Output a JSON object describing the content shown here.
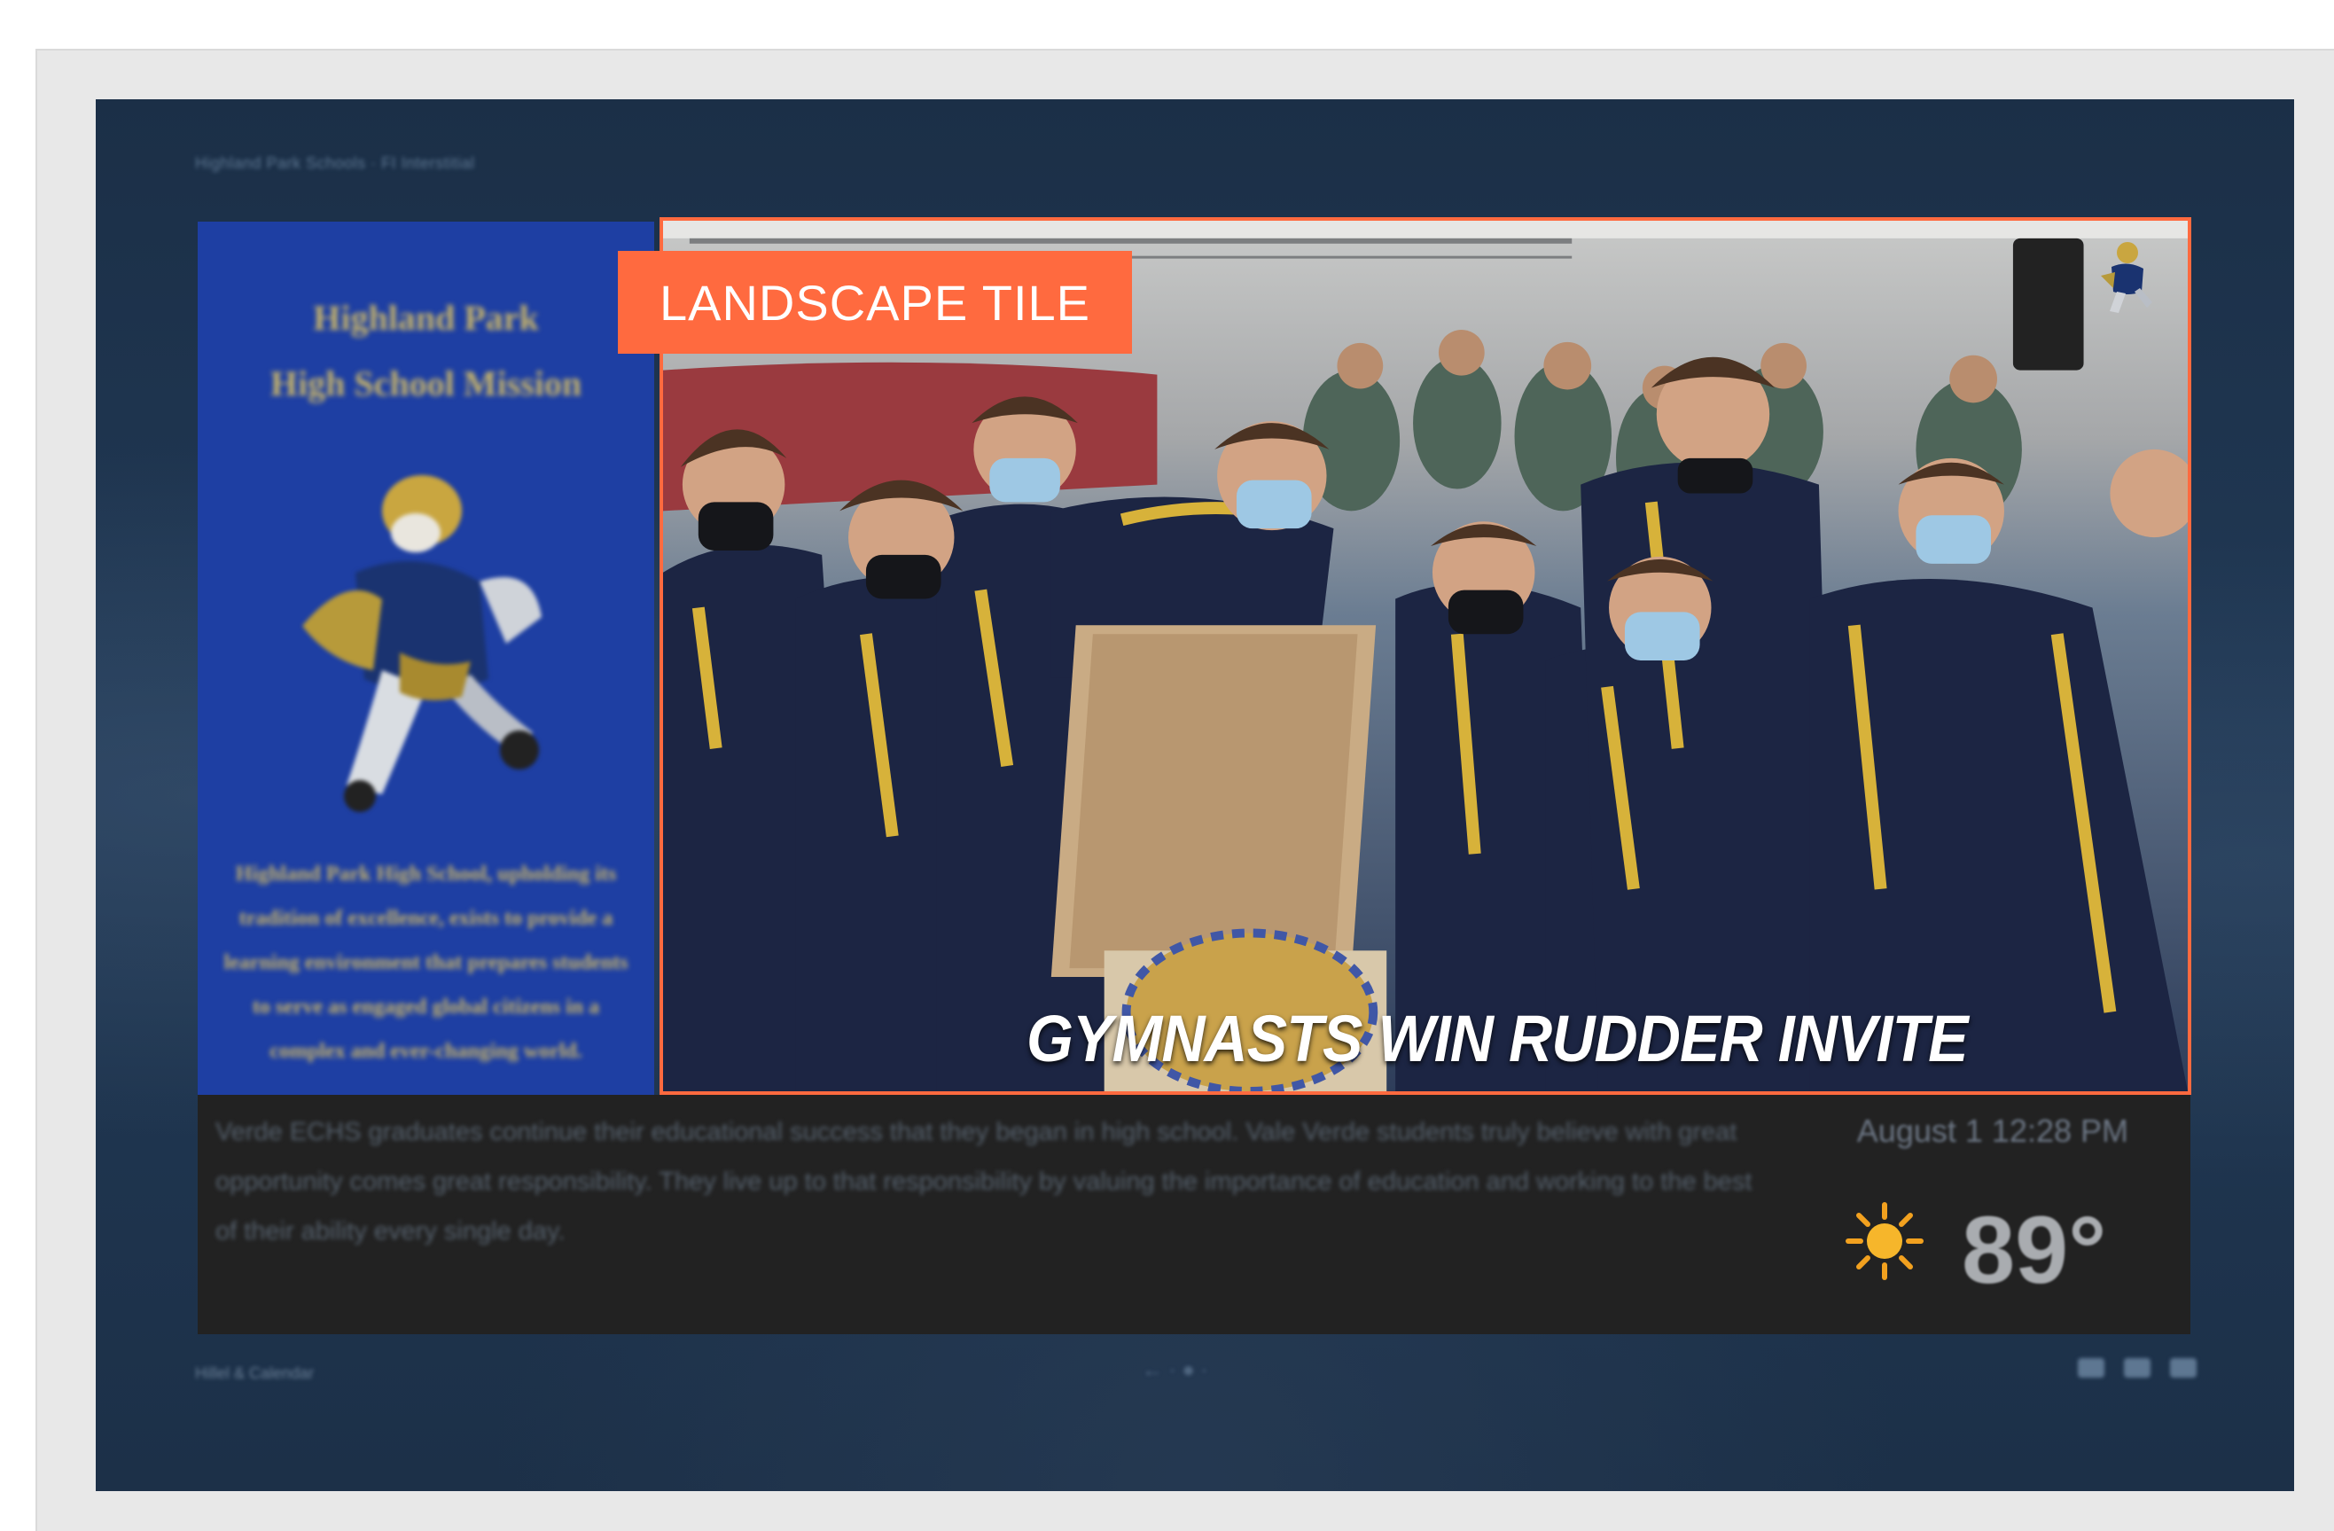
{
  "breadcrumb": "Highland Park Schools · FI Interstitial",
  "mission": {
    "title_line1": "Highland Park",
    "title_line2": "High School Mission",
    "body": "Highland Park High School, upholding its tradition of excellence, exists to provide a learning environment that prepares students to serve as engaged global citizens in a complex and ever-changing world.",
    "mascot_icon": "scot-mascot-icon"
  },
  "tile": {
    "badge_label": "LANDSCAPE TILE",
    "headline": "GYMNASTS WIN RUDDER INVITE",
    "border_color": "#ff6a3f",
    "corner_icon": "scot-mascot-icon"
  },
  "ticker": {
    "text": "Verde ECHS graduates continue their educational success that they began in high school. Vale Verde students truly believe with great opportunity comes great responsibility. They live up to that responsibility by valuing the importance of education and working to the best of their ability every single day."
  },
  "weather": {
    "datetime": "August 1 12:28 PM",
    "temperature": "89°",
    "condition_icon": "sun-icon"
  },
  "footer": {
    "left": "Hillel & Calendar",
    "center": "← · ● ·"
  },
  "colors": {
    "accent": "#ff6a3f",
    "screen_bg": "#1e3550",
    "mission_bg": "#1e3fa3",
    "ticker_bg": "#222222"
  }
}
